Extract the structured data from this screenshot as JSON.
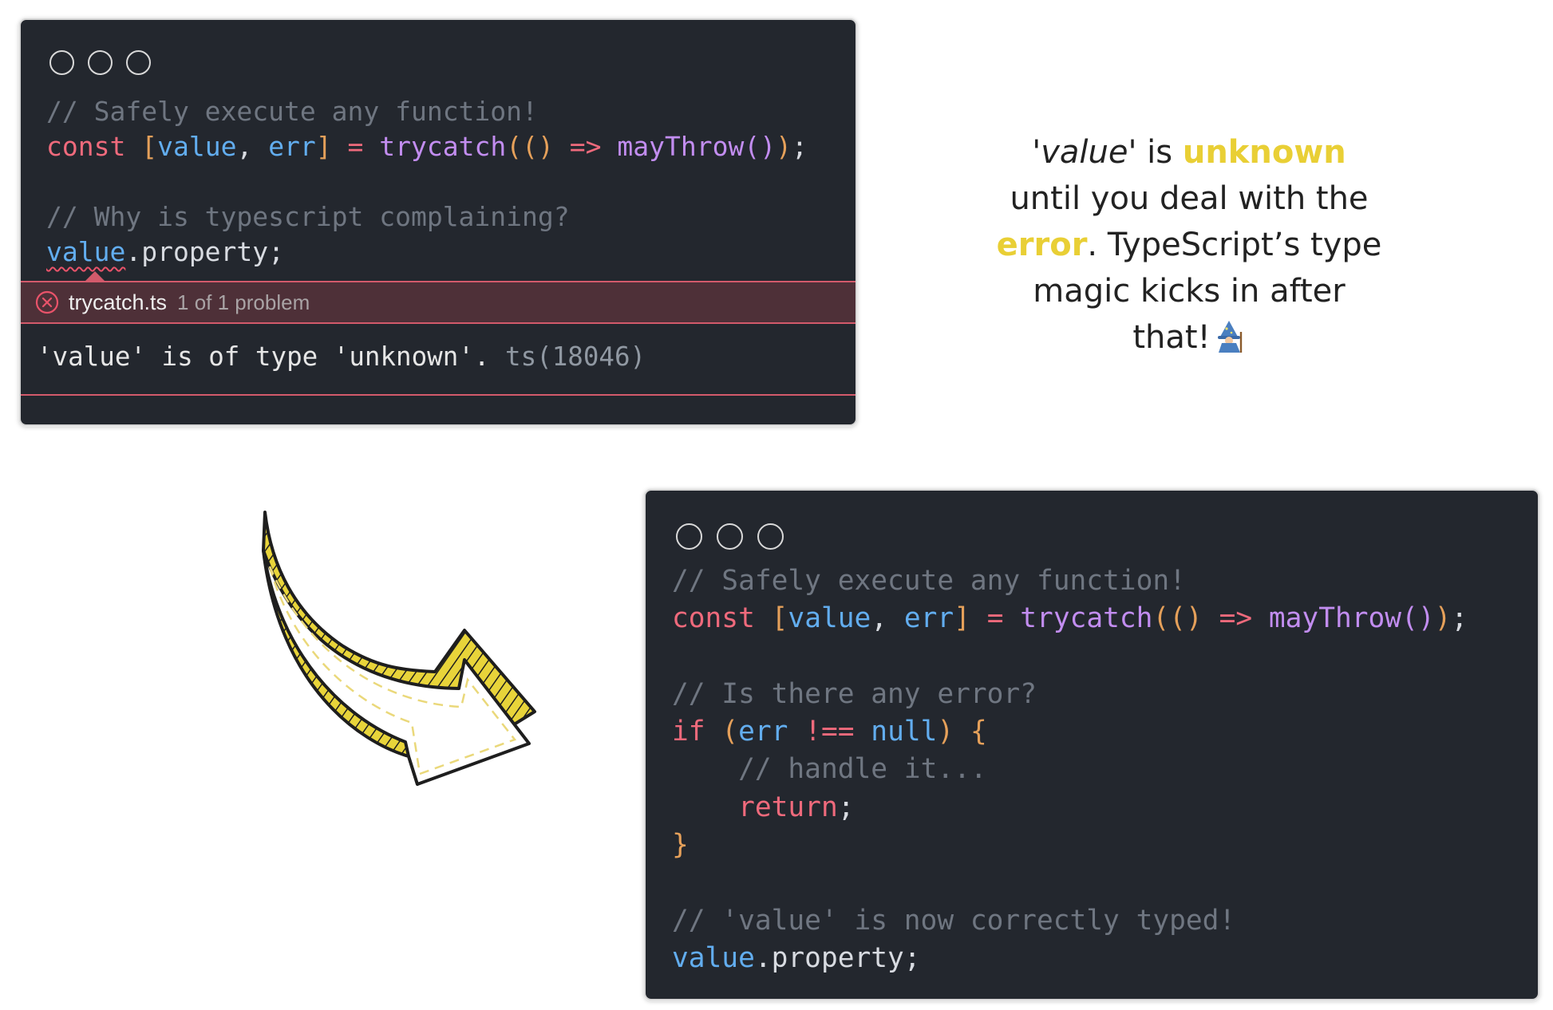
{
  "colors": {
    "background": "#ffffff",
    "editor_bg": "#23272e",
    "comment": "#6f7681",
    "keyword": "#ef6a7c",
    "bracket": "#e5a05a",
    "variable": "#62adef",
    "function": "#c28df0",
    "error_accent": "#d35a6b",
    "highlight_yellow": "#e9cf35"
  },
  "editor1": {
    "comment1": "// Safely execute any function!",
    "line2": {
      "kw": "const",
      "open": "[",
      "v1": "value",
      "comma": ",",
      "v2": "err",
      "close": "]",
      "eq": "=",
      "fn": "trycatch",
      "p1": "((",
      "pc": ")",
      "arrow": "=>",
      "fn2": "mayThrow",
      "p2": "()",
      "p3": ")",
      "semi": ";"
    },
    "comment2": "// Why is typescript complaining?",
    "line5": {
      "v": "value",
      "rest": ".property;"
    },
    "error": {
      "icon": "error-circle-x-icon",
      "file": "trycatch.ts",
      "count": "1 of 1 problem",
      "message": "'value' is of type 'unknown'.",
      "code": "ts(18046)"
    }
  },
  "caption": {
    "q1": "'value'",
    "t1": "is",
    "h1": "unknown",
    "t2": "until you deal with the",
    "h2": "error",
    "t3": ". TypeScript’s type",
    "t4": "magic kicks in after",
    "t5": "that!",
    "emoji": "wizard-icon"
  },
  "arrow": {
    "icon": "curved-arrow-icon"
  },
  "editor2": {
    "comment1": "// Safely execute any function!",
    "line2": {
      "kw": "const",
      "open": "[",
      "v1": "value",
      "comma": ",",
      "v2": "err",
      "close": "]",
      "eq": "=",
      "fn": "trycatch",
      "p1": "((",
      "pc": ")",
      "arrow": "=>",
      "fn2": "mayThrow",
      "p2": "()",
      "p3": ")",
      "semi": ";"
    },
    "comment2": "// Is there any error?",
    "if_kw": "if",
    "if_open": "(",
    "if_var": "err",
    "if_op": "!==",
    "if_null": "null",
    "if_close": ")",
    "if_brace": "{",
    "comment3": "// handle it...",
    "return_kw": "return",
    "return_semi": ";",
    "close_brace": "}",
    "comment4": "// 'value' is now correctly typed!",
    "last_v": "value",
    "last_rest": ".property;"
  }
}
